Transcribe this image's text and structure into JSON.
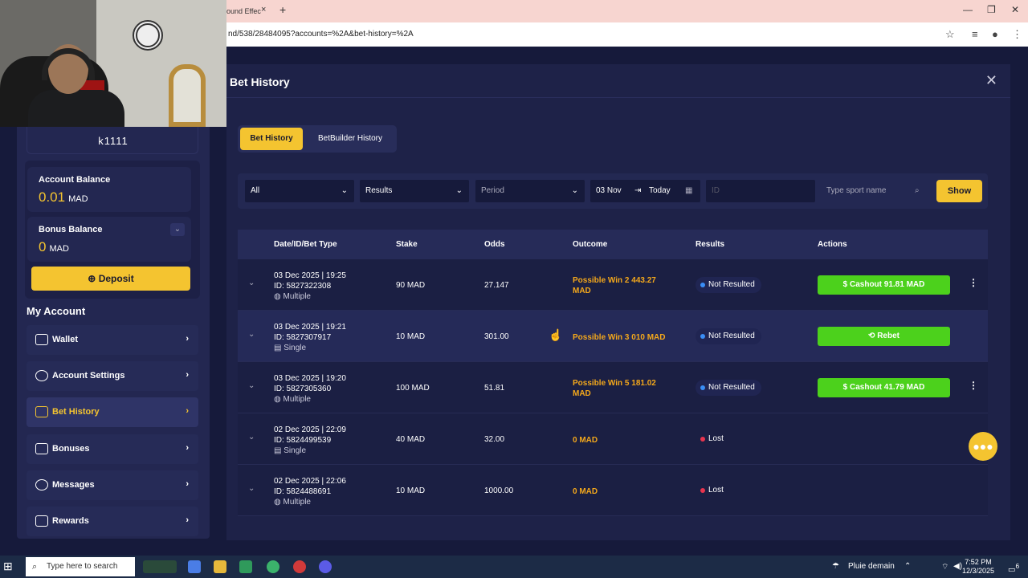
{
  "browser": {
    "tab_title": "ound Effec",
    "tab_close": "×",
    "new_tab": "+",
    "url": "nd/538/28484095?accounts=%2A&bet-history=%2A",
    "win_min": "—",
    "win_restore": "❐",
    "win_close": "✕"
  },
  "sidebar": {
    "username": "k1111",
    "account_balance": {
      "label": "Account Balance",
      "value": "0.01",
      "currency": "MAD"
    },
    "bonus_balance": {
      "label": "Bonus Balance",
      "value": "0",
      "currency": "MAD"
    },
    "deposit_label": "Deposit",
    "my_account_title": "My Account",
    "items": [
      {
        "label": "Wallet",
        "icon": "wallet-icon"
      },
      {
        "label": "Account Settings",
        "icon": "user-icon"
      },
      {
        "label": "Bet History",
        "icon": "history-icon",
        "active": true
      },
      {
        "label": "Bonuses",
        "icon": "gift-icon"
      },
      {
        "label": "Messages",
        "icon": "message-icon"
      },
      {
        "label": "Rewards",
        "icon": "rewards-icon"
      }
    ]
  },
  "modal": {
    "title": "Bet History",
    "close": "✕",
    "tabs": [
      {
        "label": "Bet History",
        "active": true
      },
      {
        "label": "BetBuilder History",
        "active": false
      }
    ],
    "filters": {
      "account": "All",
      "results": "Results",
      "period": "Period",
      "date_from": "03 Nov",
      "date_to": "Today",
      "id_placeholder": "ID",
      "sport_placeholder": "Type sport name",
      "show_label": "Show"
    },
    "table": {
      "headers": [
        "Date/ID/Bet Type",
        "Stake",
        "Odds",
        "Outcome",
        "Results",
        "Actions"
      ],
      "rows": [
        {
          "date": "03 Dec 2025 | 19:25",
          "id": "ID: 5827322308",
          "type": "Multiple",
          "stake": "90 MAD",
          "odds": "27.147",
          "outcome_1": "Possible Win 2 443.27",
          "outcome_2": "MAD",
          "result": "Not Resulted",
          "action": "Cashout 91.81 MAD",
          "has_kebab": true
        },
        {
          "date": "03 Dec 2025 | 19:21",
          "id": "ID: 5827307917",
          "type": "Single",
          "stake": "10 MAD",
          "odds": "301.00",
          "outcome_1": "Possible Win 3 010 MAD",
          "outcome_2": "",
          "result": "Not Resulted",
          "action": "Rebet",
          "has_kebab": false
        },
        {
          "date": "03 Dec 2025 | 19:20",
          "id": "ID: 5827305360",
          "type": "Multiple",
          "stake": "100 MAD",
          "odds": "51.81",
          "outcome_1": "Possible Win 5 181.02",
          "outcome_2": "MAD",
          "result": "Not Resulted",
          "action": "Cashout 41.79 MAD",
          "has_kebab": true
        },
        {
          "date": "02 Dec 2025 | 22:09",
          "id": "ID: 5824499539",
          "type": "Single",
          "stake": "40 MAD",
          "odds": "32.00",
          "outcome_1": "0 MAD",
          "outcome_2": "",
          "result": "Lost",
          "action": "",
          "has_kebab": false
        },
        {
          "date": "02 Dec 2025 | 22:06",
          "id": "ID: 5824488691",
          "type": "Multiple",
          "stake": "10 MAD",
          "odds": "1000.00",
          "outcome_1": "0 MAD",
          "outcome_2": "",
          "result": "Lost",
          "action": "",
          "has_kebab": false
        }
      ]
    }
  },
  "taskbar": {
    "search_placeholder": "Type here to search",
    "weather": "Pluie demain",
    "time": "7:52 PM",
    "date": "12/3/2025",
    "notif_count": "6"
  },
  "colors": {
    "accent": "#f4c430",
    "green": "#4cd11c",
    "bg": "#161a3b",
    "not_resulted_dot": "#3a8ef6",
    "lost_dot": "#e8344e"
  }
}
